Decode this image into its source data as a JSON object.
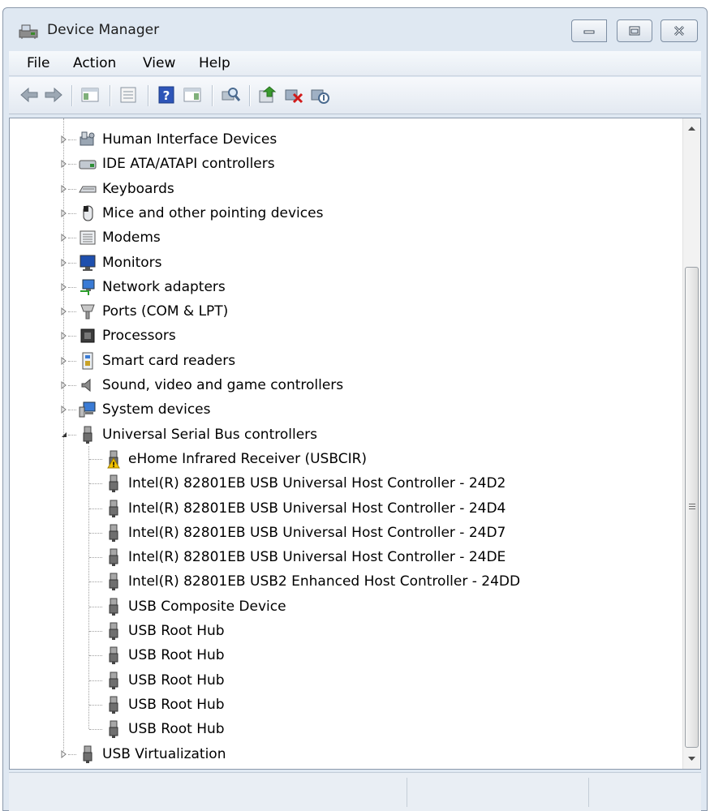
{
  "window": {
    "title": "Device Manager"
  },
  "menu": {
    "items": [
      "File",
      "Action",
      "View",
      "Help"
    ]
  },
  "toolbar": {
    "buttons": [
      "back-icon",
      "forward-icon",
      "show-hide-console-tree-icon",
      "properties-icon",
      "help-icon",
      "action-pane-icon",
      "scan-hardware-icon",
      "update-driver-icon",
      "uninstall-icon",
      "disable-icon"
    ]
  },
  "tree": {
    "categories_collapsed": [
      "Human Interface Devices",
      "IDE ATA/ATAPI controllers",
      "Keyboards",
      "Mice and other pointing devices",
      "Modems",
      "Monitors",
      "Network adapters",
      "Ports (COM & LPT)",
      "Processors",
      "Smart card readers",
      "Sound, video and game controllers",
      "System devices"
    ],
    "expanded_category": "Universal Serial Bus controllers",
    "usb_devices": [
      "eHome Infrared Receiver (USBCIR)",
      "Intel(R) 82801EB USB Universal Host Controller - 24D2",
      "Intel(R) 82801EB USB Universal Host Controller - 24D4",
      "Intel(R) 82801EB USB Universal Host Controller - 24D7",
      "Intel(R) 82801EB USB Universal Host Controller - 24DE",
      "Intel(R) 82801EB USB2 Enhanced Host Controller - 24DD",
      "USB Composite Device",
      "USB Root Hub",
      "USB Root Hub",
      "USB Root Hub",
      "USB Root Hub",
      "USB Root Hub"
    ],
    "last_category": "USB Virtualization"
  },
  "colors": {
    "chrome": "#dfe8f2",
    "warning": "#f2c200",
    "close_x": "#d11a1a"
  }
}
